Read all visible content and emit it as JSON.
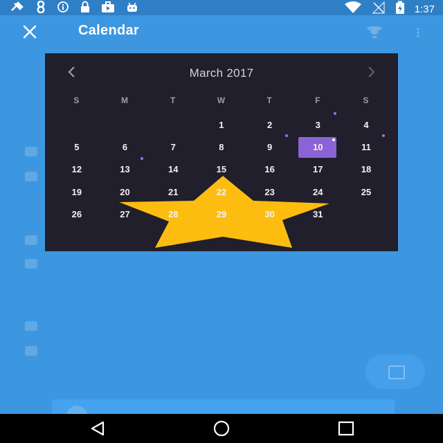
{
  "status_bar": {
    "time": "1:37",
    "left_icons": [
      "satellite-icon",
      "eight-icon",
      "info-icon",
      "lock-icon",
      "briefcase-icon",
      "android-icon"
    ],
    "right_icons": [
      "wifi-icon",
      "no-signal-icon",
      "battery-charging-icon"
    ]
  },
  "header": {
    "title": "Calendar",
    "close_icon": "close-icon"
  },
  "calendar": {
    "month_label": "March 2017",
    "weekdays": [
      "S",
      "M",
      "T",
      "W",
      "T",
      "F",
      "S"
    ],
    "selected_day": "10",
    "weeks": [
      [
        {
          "day": ""
        },
        {
          "day": ""
        },
        {
          "day": ""
        },
        {
          "day": "1"
        },
        {
          "day": "2"
        },
        {
          "day": "3",
          "dot": true
        },
        {
          "day": "4"
        }
      ],
      [
        {
          "day": "5"
        },
        {
          "day": "6"
        },
        {
          "day": "7"
        },
        {
          "day": "8"
        },
        {
          "day": "9",
          "dot": true
        },
        {
          "day": "10",
          "dot": true,
          "selected": true
        },
        {
          "day": "11",
          "dot": true
        }
      ],
      [
        {
          "day": "12"
        },
        {
          "day": "13",
          "dot": true
        },
        {
          "day": "14"
        },
        {
          "day": "15"
        },
        {
          "day": "16"
        },
        {
          "day": "17"
        },
        {
          "day": "18"
        }
      ],
      [
        {
          "day": "19"
        },
        {
          "day": "20"
        },
        {
          "day": "21"
        },
        {
          "day": "22"
        },
        {
          "day": "23"
        },
        {
          "day": "24"
        },
        {
          "day": "25"
        }
      ],
      [
        {
          "day": "26"
        },
        {
          "day": "27"
        },
        {
          "day": "28"
        },
        {
          "day": "29"
        },
        {
          "day": "30"
        },
        {
          "day": "31"
        },
        {
          "day": ""
        }
      ]
    ]
  },
  "colors": {
    "background": "#3d96e0",
    "dialog": "#201f2b",
    "selected": "#8b63d6",
    "event_dot": "#a56ee6",
    "star": "#fdbd10"
  },
  "navigation": {
    "back": "back-icon",
    "home": "home-icon",
    "recents": "recents-icon"
  }
}
